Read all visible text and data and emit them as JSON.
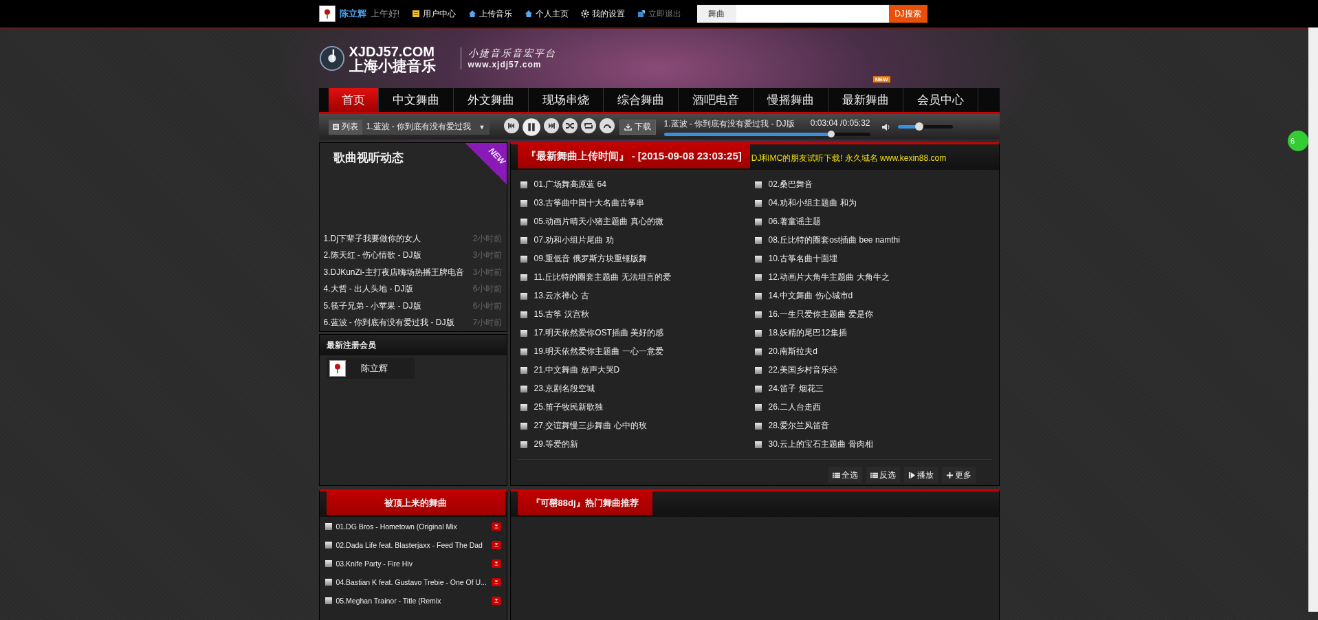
{
  "top_bar": {
    "user_name": "陈立辉",
    "greeting": "上午好!",
    "links": [
      {
        "label": "用户中心",
        "kind": "note",
        "disabled": false
      },
      {
        "label": "上传音乐",
        "kind": "home",
        "disabled": false
      },
      {
        "label": "个人主页",
        "kind": "home",
        "disabled": false
      },
      {
        "label": "我的设置",
        "kind": "gear",
        "disabled": false
      },
      {
        "label": "立即退出",
        "kind": "exit",
        "disabled": true
      }
    ],
    "search": {
      "category": "舞曲",
      "button": "DJ搜索"
    }
  },
  "header": {
    "logo_title": "XJDJ57.COM",
    "logo_name": "上海小捷音乐",
    "slogan": "小捷音乐音宏平台",
    "slogan_url": "www.xjdj57.com"
  },
  "nav": [
    {
      "label": "首页",
      "selected": true
    },
    {
      "label": "中文舞曲",
      "selected": false
    },
    {
      "label": "外文舞曲",
      "selected": false
    },
    {
      "label": "现场串烧",
      "selected": false
    },
    {
      "label": "综合舞曲",
      "selected": false
    },
    {
      "label": "酒吧电音",
      "selected": false
    },
    {
      "label": "慢摇舞曲",
      "selected": false
    },
    {
      "label": "最新舞曲",
      "selected": false,
      "badge": "NEW"
    },
    {
      "label": "会员中心",
      "selected": false
    }
  ],
  "player": {
    "list_button": "列表",
    "current_select": "1.蓝波 - 你到底有没有爱过我",
    "caret": "▼",
    "download": "下载",
    "now_playing": "1.蓝波 - 你到底有没有爱过我 - DJ版",
    "time": "0:03:04 /0:05:32",
    "progress": {
      "level": 0.81
    },
    "volume": {
      "level": 0.39
    }
  },
  "listen_panel": {
    "title": "歌曲视听动态",
    "ribbon": "NEW",
    "items": [
      {
        "title": "1.Dj下辈子我要做你的女人",
        "time": "2小时前"
      },
      {
        "title": "2.陈天红 - 伤心情歌 - DJ版",
        "time": "3小时前"
      },
      {
        "title": "3.DJKunZi-主打夜店嗨场热播王牌电音",
        "time": "3小时前"
      },
      {
        "title": "4.大哲 - 出人头地 - DJ版",
        "time": "6小时前"
      },
      {
        "title": "5.筷子兄弟 - 小苹果 - DJ版",
        "time": "6小时前"
      },
      {
        "title": "6.蓝波 - 你到底有没有爱过我 - DJ版",
        "time": "7小时前"
      }
    ]
  },
  "members_panel": {
    "title": "最新注册会员",
    "members": [
      {
        "name": "陈立辉"
      }
    ]
  },
  "latest_panel": {
    "title": "『最新舞曲上传时间』 - [2015-09-08 23:03:25]",
    "notice": "DJ和MC的朋友试听下载! 永久域名 www.kexin88.com",
    "songs": [
      {
        "title": "01.广场舞高原蓝 64",
        "checked": false
      },
      {
        "title": "02.桑巴舞音",
        "checked": false
      },
      {
        "title": "03.古筝曲中国十大名曲古筝串",
        "checked": false
      },
      {
        "title": "04.劝和小组主题曲 和为",
        "checked": false
      },
      {
        "title": "05.动画片晴天小猪主题曲 真心的微",
        "checked": false
      },
      {
        "title": "06.著童谣主题",
        "checked": false
      },
      {
        "title": "07.劝和小组片尾曲 劝",
        "checked": false
      },
      {
        "title": "08.丘比特的圈套ost插曲 bee namthi",
        "checked": false
      },
      {
        "title": "09.重低音 俄罗斯方块重锤版舞",
        "checked": false
      },
      {
        "title": "10.古筝名曲十面埋",
        "checked": false
      },
      {
        "title": "11.丘比特的圈套主题曲 无法坦言的爱",
        "checked": false
      },
      {
        "title": "12.动画片大角牛主题曲 大角牛之",
        "checked": false
      },
      {
        "title": "13.云水禅心 古",
        "checked": false
      },
      {
        "title": "14.中文舞曲 伤心城市d",
        "checked": false
      },
      {
        "title": "15.古筝 汉宫秋",
        "checked": false
      },
      {
        "title": "16.一生只爱你主题曲 爱是你",
        "checked": false
      },
      {
        "title": "17.明天依然爱你OST插曲 美好的感",
        "checked": false
      },
      {
        "title": "18.妖精的尾巴12集插",
        "checked": false
      },
      {
        "title": "19.明天依然爱你主题曲 一心一意爱",
        "checked": false
      },
      {
        "title": "20.南斯拉夫d",
        "checked": false
      },
      {
        "title": "21.中文舞曲 放声大哭D",
        "checked": false
      },
      {
        "title": "22.美国乡村音乐经",
        "checked": false
      },
      {
        "title": "23.京剧名段空城",
        "checked": false
      },
      {
        "title": "24.笛子 烟花三",
        "checked": false
      },
      {
        "title": "25.笛子牧民新歌独",
        "checked": false
      },
      {
        "title": "26.二人台走西",
        "checked": false
      },
      {
        "title": "27.交谊舞慢三步舞曲 心中的玫",
        "checked": false
      },
      {
        "title": "28.爱尔兰风笛音",
        "checked": false
      },
      {
        "title": "29.等爱的新",
        "checked": false
      },
      {
        "title": "30.云上的宝石主题曲 骨肉相",
        "checked": false
      }
    ],
    "actions": [
      {
        "label": "全选",
        "kind": "list"
      },
      {
        "label": "反选",
        "kind": "list"
      },
      {
        "label": "播放",
        "kind": "play"
      },
      {
        "label": "更多",
        "kind": "plus"
      }
    ]
  },
  "topped_panel": {
    "title": "被顶上来的舞曲",
    "songs": [
      {
        "title": "01.DG Bros - Hometown (Original Mix",
        "checked": false
      },
      {
        "title": "02.Dada Life feat. Blasterjaxx - Feed The Dad",
        "checked": false
      },
      {
        "title": "03.Knife Party - Fire Hiv",
        "checked": false
      },
      {
        "title": "04.Bastian K feat. Gustavo Trebie - One Of U...",
        "checked": false
      },
      {
        "title": "05.Meghan Trainor - Title (Remix",
        "checked": false
      }
    ]
  },
  "hot_panel": {
    "title": "『可罄88dj』热门舞曲推荐"
  },
  "side_badge": "6"
}
